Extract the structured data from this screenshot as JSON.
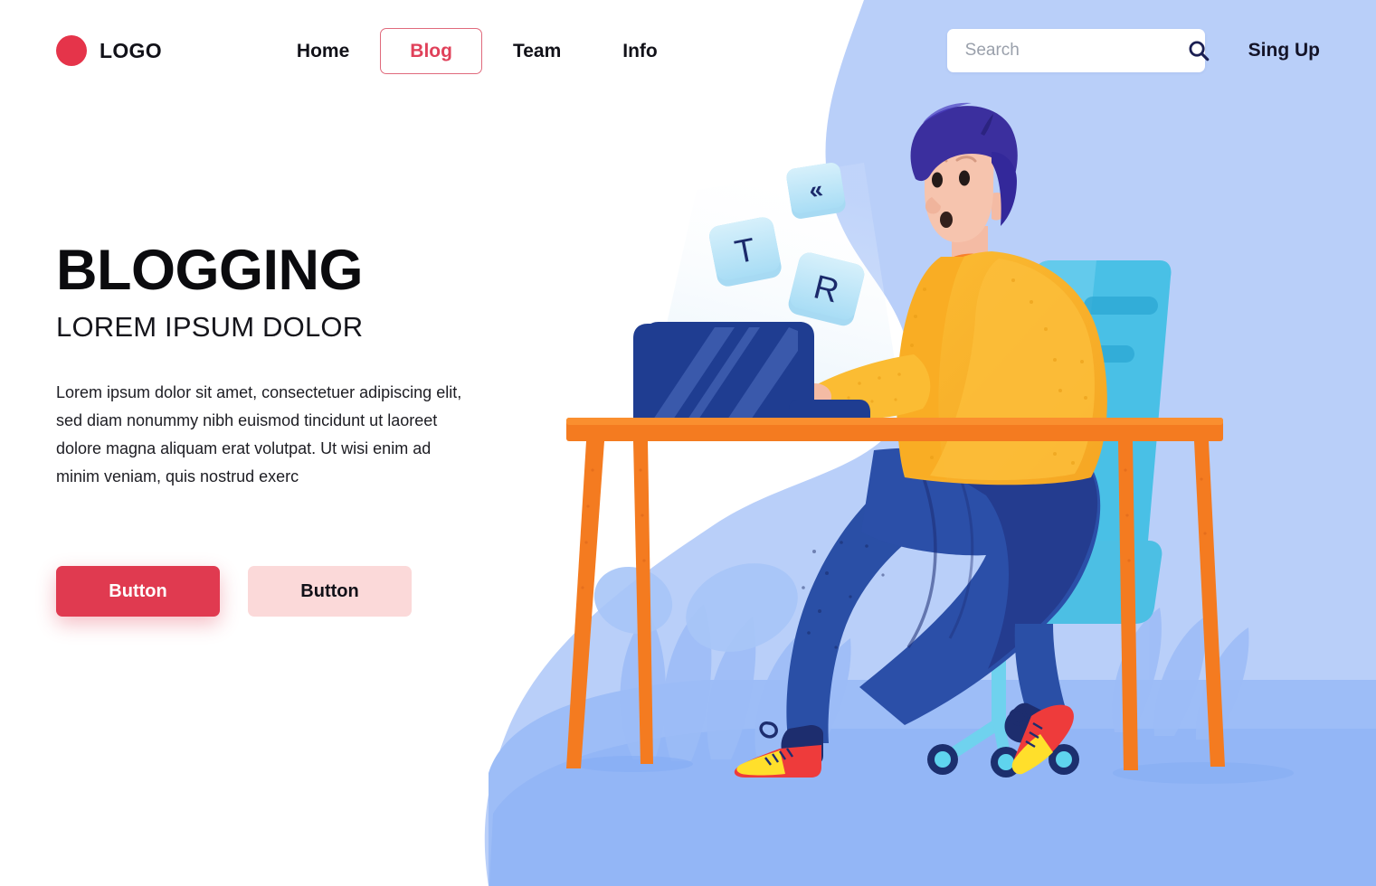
{
  "header": {
    "logo": {
      "text": "LOGO",
      "icon": "logo-circle-icon",
      "color": "#e5344a"
    },
    "nav": [
      {
        "label": "Home",
        "active": false
      },
      {
        "label": "Blog",
        "active": true
      },
      {
        "label": "Team",
        "active": false
      },
      {
        "label": "Info",
        "active": false
      }
    ],
    "search": {
      "placeholder": "Search",
      "value": "",
      "icon": "search-icon"
    },
    "signup_label": "Sing Up"
  },
  "hero": {
    "title": "BLOGGING",
    "subtitle": "LOREM IPSUM DOLOR",
    "paragraph": "Lorem ipsum dolor sit amet, consectetuer adipiscing elit, sed diam nonummy nibh euismod tincidunt ut laoreet dolore magna aliquam erat volutpat. Ut wisi enim ad minim veniam, quis nostrud exerc",
    "primary_button": "Button",
    "secondary_button": "Button"
  },
  "illustration": {
    "name": "man-blogging-at-desk-illustration",
    "floating_keys": [
      {
        "label": "«",
        "name": "keycap-backspace"
      },
      {
        "label": "T",
        "name": "keycap-t"
      },
      {
        "label": "R",
        "name": "keycap-r"
      }
    ],
    "objects": [
      "laptop",
      "desk",
      "office-chair",
      "character",
      "sneakers",
      "plants"
    ]
  },
  "colors": {
    "accent_red": "#e03a50",
    "accent_red_soft": "#fbd9d9",
    "background_blue": "#b9cff9",
    "floor_blue": "#8fb5f6",
    "desk_orange": "#f47b20",
    "cardigan_yellow": "#f9b42c",
    "shirt_orange": "#f8802a",
    "jeans_blue": "#2b4fa8",
    "hair_indigo": "#3b2f9e",
    "laptop_navy": "#1f3d91",
    "chair_cyan": "#56c4e8",
    "keycap_blue": "#bfe6f8",
    "key_letter_navy": "#1b2a6b",
    "shoe_red": "#ee3b3b",
    "shoe_yellow": "#ffdf2b",
    "skin": "#f6c4ae"
  }
}
